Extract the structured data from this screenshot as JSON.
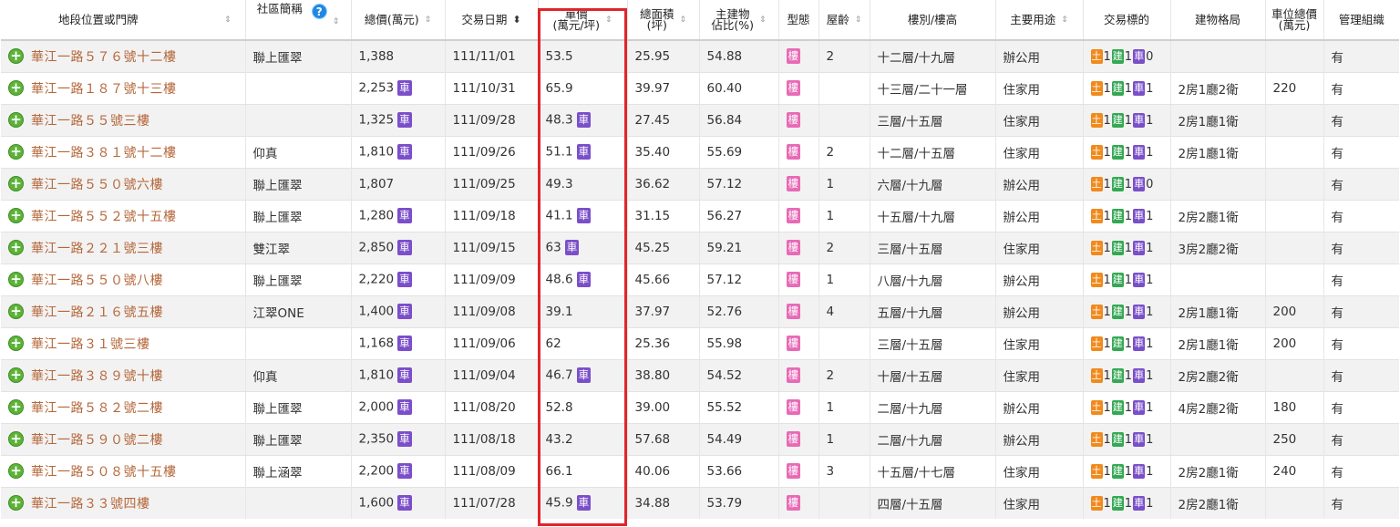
{
  "headers": {
    "address": "地段位置或門牌",
    "community": "社區簡稱",
    "help": "?",
    "total_price": "總價(萬元)",
    "date": "交易日期",
    "unit_price_l1": "單價",
    "unit_price_l2": "(萬元/坪)",
    "area_l1": "總面積",
    "area_l2": "(坪)",
    "main_ratio_l1": "主建物",
    "main_ratio_l2": "佔比(%)",
    "type": "型態",
    "age": "屋齡",
    "floor": "樓別/樓高",
    "usage": "主要用途",
    "target": "交易標的",
    "layout": "建物格局",
    "parking_l1": "車位總價",
    "parking_l2": "(萬元)",
    "management": "管理組織"
  },
  "sort_icons": {
    "neutral": "⇕",
    "active": "⬍"
  },
  "badges": {
    "car": "車",
    "type": "樓",
    "land": "土",
    "building": "建",
    "parking": "車"
  },
  "rows": [
    {
      "address": "華江一路５７６號十二樓",
      "community": "聯上匯翠",
      "total": "1,388",
      "total_car": false,
      "date": "111/11/01",
      "unit": "53.5",
      "unit_car": false,
      "area": "25.95",
      "ratio": "54.88",
      "age": "2",
      "floor": "十二層/十九層",
      "usage": "辦公用",
      "t_land": "1",
      "t_bld": "1",
      "t_car": "0",
      "layout": "",
      "parking": "",
      "mgmt": "有"
    },
    {
      "address": "華江一路１８７號十三樓",
      "community": "",
      "total": "2,253",
      "total_car": true,
      "date": "111/10/31",
      "unit": "65.9",
      "unit_car": false,
      "area": "39.97",
      "ratio": "60.40",
      "age": "",
      "floor": "十三層/二十一層",
      "usage": "住家用",
      "t_land": "1",
      "t_bld": "1",
      "t_car": "1",
      "layout": "2房1廳2衛",
      "parking": "220",
      "mgmt": "有"
    },
    {
      "address": "華江一路５５號三樓",
      "community": "",
      "total": "1,325",
      "total_car": true,
      "date": "111/09/28",
      "unit": "48.3",
      "unit_car": true,
      "area": "27.45",
      "ratio": "56.84",
      "age": "",
      "floor": "三層/十五層",
      "usage": "住家用",
      "t_land": "1",
      "t_bld": "1",
      "t_car": "1",
      "layout": "2房1廳1衛",
      "parking": "",
      "mgmt": "有"
    },
    {
      "address": "華江一路３８１號十二樓",
      "community": "仰真",
      "total": "1,810",
      "total_car": true,
      "date": "111/09/26",
      "unit": "51.1",
      "unit_car": true,
      "area": "35.40",
      "ratio": "55.69",
      "age": "2",
      "floor": "十二層/十五層",
      "usage": "住家用",
      "t_land": "1",
      "t_bld": "1",
      "t_car": "1",
      "layout": "2房1廳1衛",
      "parking": "",
      "mgmt": "有"
    },
    {
      "address": "華江一路５５０號六樓",
      "community": "聯上匯翠",
      "total": "1,807",
      "total_car": false,
      "date": "111/09/25",
      "unit": "49.3",
      "unit_car": false,
      "area": "36.62",
      "ratio": "57.12",
      "age": "1",
      "floor": "六層/十九層",
      "usage": "辦公用",
      "t_land": "1",
      "t_bld": "1",
      "t_car": "0",
      "layout": "",
      "parking": "",
      "mgmt": "有"
    },
    {
      "address": "華江一路５５２號十五樓",
      "community": "聯上匯翠",
      "total": "1,280",
      "total_car": true,
      "date": "111/09/18",
      "unit": "41.1",
      "unit_car": true,
      "area": "31.15",
      "ratio": "56.27",
      "age": "1",
      "floor": "十五層/十九層",
      "usage": "辦公用",
      "t_land": "1",
      "t_bld": "1",
      "t_car": "1",
      "layout": "2房2廳1衛",
      "parking": "",
      "mgmt": "有"
    },
    {
      "address": "華江一路２２１號三樓",
      "community": "雙江翠",
      "total": "2,850",
      "total_car": true,
      "date": "111/09/15",
      "unit": "63",
      "unit_car": true,
      "area": "45.25",
      "ratio": "59.21",
      "age": "2",
      "floor": "三層/十五層",
      "usage": "住家用",
      "t_land": "1",
      "t_bld": "1",
      "t_car": "1",
      "layout": "3房2廳2衛",
      "parking": "",
      "mgmt": "有"
    },
    {
      "address": "華江一路５５０號八樓",
      "community": "聯上匯翠",
      "total": "2,220",
      "total_car": true,
      "date": "111/09/09",
      "unit": "48.6",
      "unit_car": true,
      "area": "45.66",
      "ratio": "57.12",
      "age": "1",
      "floor": "八層/十九層",
      "usage": "辦公用",
      "t_land": "1",
      "t_bld": "1",
      "t_car": "1",
      "layout": "",
      "parking": "",
      "mgmt": "有"
    },
    {
      "address": "華江一路２１６號五樓",
      "community": "江翠ONE",
      "total": "1,400",
      "total_car": true,
      "date": "111/09/08",
      "unit": "39.1",
      "unit_car": false,
      "area": "37.97",
      "ratio": "52.76",
      "age": "4",
      "floor": "五層/十九層",
      "usage": "辦公用",
      "t_land": "1",
      "t_bld": "1",
      "t_car": "1",
      "layout": "2房1廳1衛",
      "parking": "200",
      "mgmt": "有"
    },
    {
      "address": "華江一路３１號三樓",
      "community": "",
      "total": "1,168",
      "total_car": true,
      "date": "111/09/06",
      "unit": "62",
      "unit_car": false,
      "area": "25.36",
      "ratio": "55.98",
      "age": "",
      "floor": "三層/十五層",
      "usage": "住家用",
      "t_land": "1",
      "t_bld": "1",
      "t_car": "1",
      "layout": "2房1廳1衛",
      "parking": "200",
      "mgmt": "有"
    },
    {
      "address": "華江一路３８９號十樓",
      "community": "仰真",
      "total": "1,810",
      "total_car": true,
      "date": "111/09/04",
      "unit": "46.7",
      "unit_car": true,
      "area": "38.80",
      "ratio": "54.52",
      "age": "2",
      "floor": "十層/十五層",
      "usage": "住家用",
      "t_land": "1",
      "t_bld": "1",
      "t_car": "1",
      "layout": "2房2廳2衛",
      "parking": "",
      "mgmt": "有"
    },
    {
      "address": "華江一路５８２號二樓",
      "community": "聯上匯翠",
      "total": "2,000",
      "total_car": true,
      "date": "111/08/20",
      "unit": "52.8",
      "unit_car": false,
      "area": "39.00",
      "ratio": "55.52",
      "age": "1",
      "floor": "二層/十九層",
      "usage": "辦公用",
      "t_land": "1",
      "t_bld": "1",
      "t_car": "1",
      "layout": "4房2廳2衛",
      "parking": "180",
      "mgmt": "有"
    },
    {
      "address": "華江一路５９０號二樓",
      "community": "聯上匯翠",
      "total": "2,350",
      "total_car": true,
      "date": "111/08/18",
      "unit": "43.2",
      "unit_car": false,
      "area": "57.68",
      "ratio": "54.49",
      "age": "1",
      "floor": "二層/十九層",
      "usage": "辦公用",
      "t_land": "1",
      "t_bld": "1",
      "t_car": "1",
      "layout": "",
      "parking": "250",
      "mgmt": "有"
    },
    {
      "address": "華江一路５０８號十五樓",
      "community": "聯上涵翠",
      "total": "2,200",
      "total_car": true,
      "date": "111/08/09",
      "unit": "66.1",
      "unit_car": false,
      "area": "40.06",
      "ratio": "53.66",
      "age": "3",
      "floor": "十五層/十七層",
      "usage": "住家用",
      "t_land": "1",
      "t_bld": "1",
      "t_car": "1",
      "layout": "2房2廳1衛",
      "parking": "240",
      "mgmt": "有"
    },
    {
      "address": "華江一路３３號四樓",
      "community": "",
      "total": "1,600",
      "total_car": true,
      "date": "111/07/28",
      "unit": "45.9",
      "unit_car": true,
      "area": "34.88",
      "ratio": "53.79",
      "age": "",
      "floor": "四層/十五層",
      "usage": "住家用",
      "t_land": "1",
      "t_bld": "1",
      "t_car": "1",
      "layout": "2房2廳1衛",
      "parking": "",
      "mgmt": "有"
    }
  ],
  "colors": {
    "highlight": "#e0252b",
    "address_link": "#b5673a",
    "car_badge": "#7b4fc9",
    "type_badge": "#e86ab6",
    "land_badge": "#f08a1c",
    "building_badge": "#34a853",
    "expand_icon": "#5cb338",
    "help_icon": "#1e88e5"
  }
}
